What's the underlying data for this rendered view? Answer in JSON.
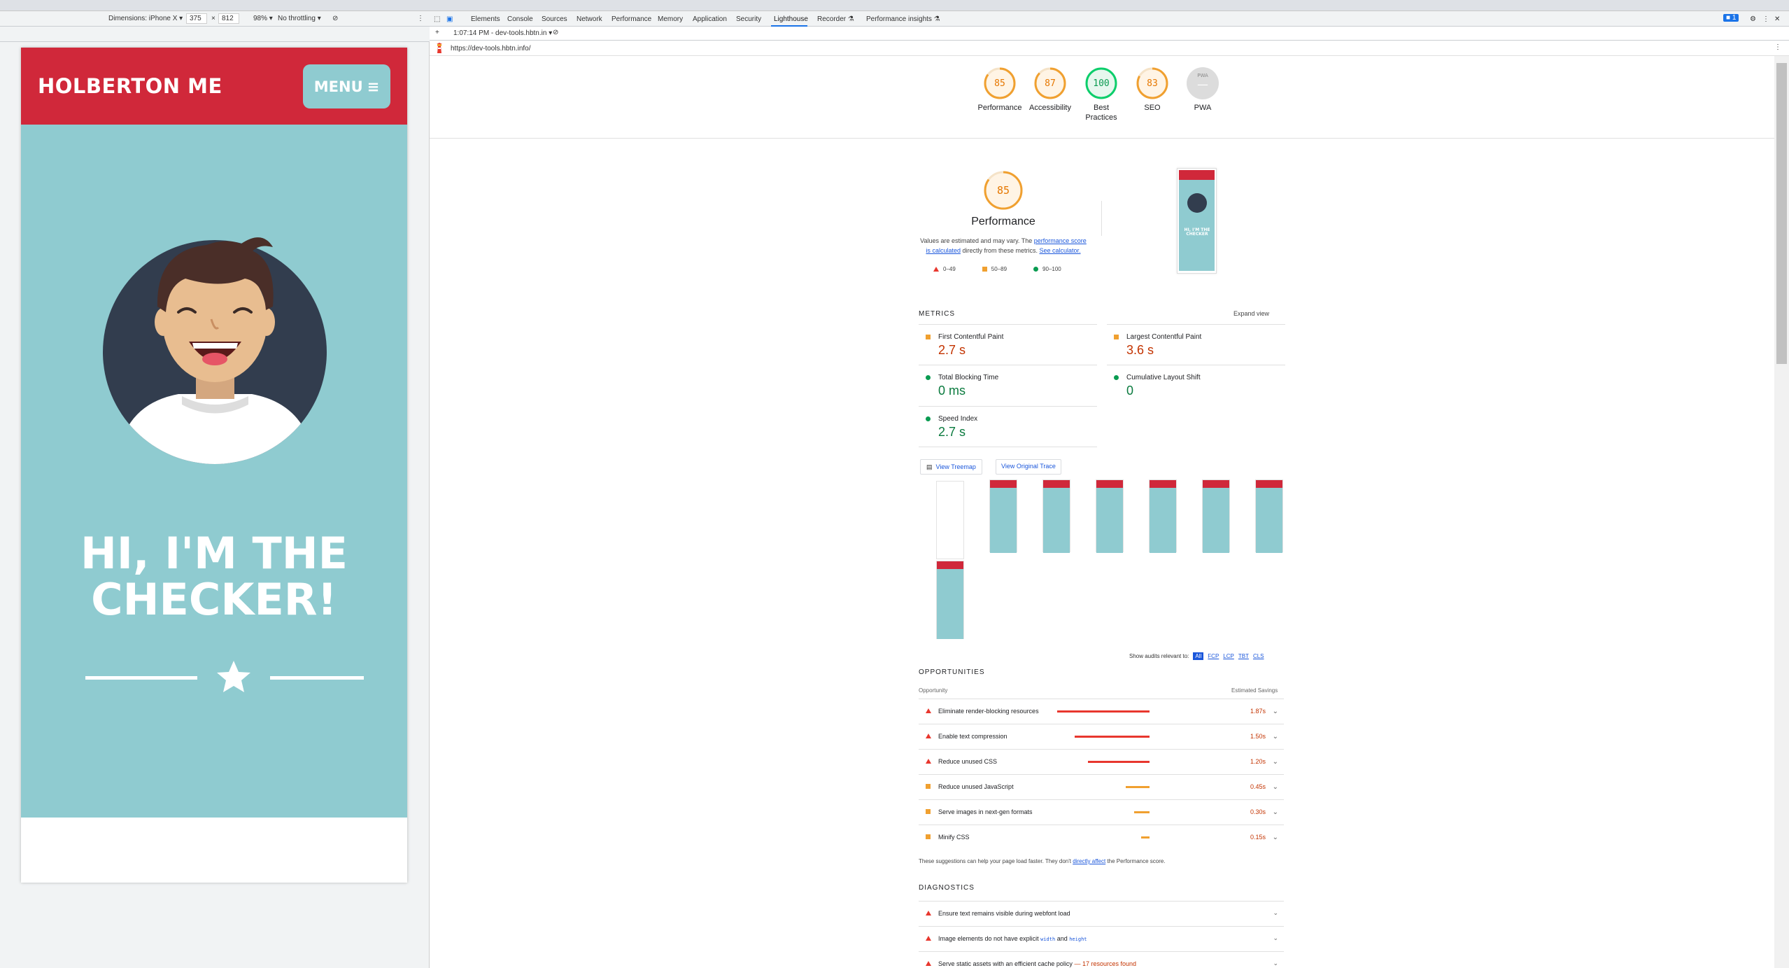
{
  "device_toolbar": {
    "dimensions_label": "Dimensions: iPhone X",
    "width": "375",
    "times": "×",
    "height": "812",
    "zoom": "98%",
    "throttling": "No throttling"
  },
  "device_page": {
    "logo": "HOLBERTON ME",
    "menu_label": "MENU",
    "hero_line1": "HI, I'M THE",
    "hero_line2": "CHECKER!"
  },
  "devtools": {
    "tabs": [
      "Elements",
      "Console",
      "Sources",
      "Network",
      "Performance",
      "Memory",
      "Application",
      "Security",
      "Lighthouse",
      "Recorder",
      "Performance insights"
    ],
    "active_tab": "Lighthouse",
    "report_time": "1:07:14 PM - dev-tools.hbtn.in",
    "url": "https://dev-tools.hbtn.info/",
    "issues_count": "1"
  },
  "scores": [
    {
      "value": "85",
      "label": "Performance",
      "color": "#e67700",
      "ring": "#f0a030",
      "fill": 0.85
    },
    {
      "value": "87",
      "label": "Accessibility",
      "color": "#e67700",
      "ring": "#f0a030",
      "fill": 0.87
    },
    {
      "value": "100",
      "label": "Best Practices",
      "color": "#0a9b51",
      "ring": "#0cce6b",
      "fill": 1.0
    },
    {
      "value": "83",
      "label": "SEO",
      "color": "#e67700",
      "ring": "#f0a030",
      "fill": 0.83
    },
    {
      "value": "—",
      "label": "PWA",
      "color": "#ffffff",
      "ring": "#cfcfcf",
      "fill": 0,
      "badge": "PWA"
    }
  ],
  "perf": {
    "score": "85",
    "title": "Performance",
    "desc_prefix": "Values are estimated and may vary. The ",
    "desc_link1": "performance score is calculated",
    "desc_mid": " directly from these metrics. ",
    "desc_link2": "See calculator.",
    "legend": [
      "0–49",
      "50–89",
      "90–100"
    ]
  },
  "metrics_section": {
    "title": "METRICS",
    "expand": "Expand view",
    "items": [
      {
        "name": "First Contentful Paint",
        "value": "2.7 s",
        "status": "average"
      },
      {
        "name": "Largest Contentful Paint",
        "value": "3.6 s",
        "status": "average"
      },
      {
        "name": "Total Blocking Time",
        "value": "0 ms",
        "status": "pass"
      },
      {
        "name": "Cumulative Layout Shift",
        "value": "0",
        "status": "pass"
      },
      {
        "name": "Speed Index",
        "value": "2.7 s",
        "status": "pass"
      }
    ],
    "view_treemap": "View Treemap",
    "view_trace": "View Original Trace"
  },
  "filter": {
    "label": "Show audits relevant to:",
    "options": [
      "All",
      "FCP",
      "LCP",
      "TBT",
      "CLS"
    ]
  },
  "opportunities": {
    "title": "OPPORTUNITIES",
    "col_opportunity": "Opportunity",
    "col_savings": "Estimated Savings",
    "items": [
      {
        "name": "Eliminate render-blocking resources",
        "savings": "1.87s",
        "fraction": 1.0,
        "status": "fail"
      },
      {
        "name": "Enable text compression",
        "savings": "1.50s",
        "fraction": 0.81,
        "status": "fail"
      },
      {
        "name": "Reduce unused CSS",
        "savings": "1.20s",
        "fraction": 0.67,
        "status": "fail"
      },
      {
        "name": "Reduce unused JavaScript",
        "savings": "0.45s",
        "fraction": 0.26,
        "status": "average"
      },
      {
        "name": "Serve images in next-gen formats",
        "savings": "0.30s",
        "fraction": 0.17,
        "status": "average"
      },
      {
        "name": "Minify CSS",
        "savings": "0.15s",
        "fraction": 0.09,
        "status": "average"
      }
    ],
    "note_prefix": "These suggestions can help your page load faster. They don't ",
    "note_link": "directly affect",
    "note_suffix": " the Performance score."
  },
  "diagnostics": {
    "title": "DIAGNOSTICS",
    "items": [
      {
        "text": "Ensure text remains visible during webfont load"
      },
      {
        "text": "Image elements do not have explicit",
        "code1": "width",
        "mid": " and ",
        "code2": "height"
      },
      {
        "text": "Serve static assets with an efficient cache policy",
        "extra": "— 17 resources found"
      }
    ]
  },
  "colors": {
    "brand_red": "#d0283a",
    "brand_teal": "#8fcbd0",
    "fail": "#e8372e",
    "average": "#f0a030",
    "pass": "#0a9b51"
  }
}
